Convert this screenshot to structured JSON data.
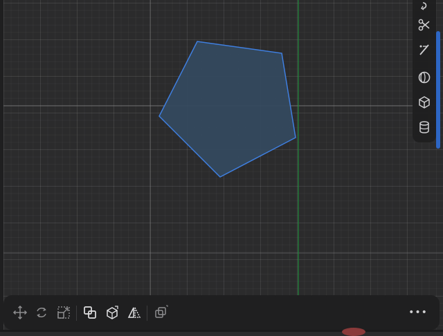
{
  "canvas": {
    "background": "#2b2b2c",
    "axis_x_color": "#8a8a8c",
    "axis_y_color": "#1f8a3b",
    "shape": {
      "type": "pentagon",
      "fill": "#34495e",
      "stroke": "#3f7fe0"
    }
  },
  "right_toolbar": {
    "tools": [
      {
        "id": "undo-curve",
        "icon": "curve-arrow-icon"
      },
      {
        "id": "scissors",
        "icon": "scissors-icon"
      },
      {
        "id": "pen",
        "icon": "pen-tool-icon"
      },
      {
        "id": "sphere",
        "icon": "sphere-icon"
      },
      {
        "id": "box",
        "icon": "cube-icon"
      },
      {
        "id": "cylinder",
        "icon": "cylinder-icon"
      }
    ]
  },
  "bottom_toolbar": {
    "tools": [
      {
        "id": "move",
        "icon": "move-arrows-icon"
      },
      {
        "id": "rotate",
        "icon": "rotate-arrows-icon"
      },
      {
        "id": "scale",
        "icon": "scale-box-icon"
      },
      {
        "id": "boolean",
        "icon": "boolean-union-icon"
      },
      {
        "id": "extrude",
        "icon": "extrude-cube-icon"
      },
      {
        "id": "mirror",
        "icon": "mirror-icon"
      },
      {
        "id": "duplicate",
        "icon": "duplicate-icon"
      }
    ],
    "more_label": "•••"
  },
  "colors": {
    "toolbar_bg": "#1f1f20",
    "icon": "#d0d0d2",
    "icon_dim": "#8e8e90",
    "accent": "#2d66c4"
  }
}
